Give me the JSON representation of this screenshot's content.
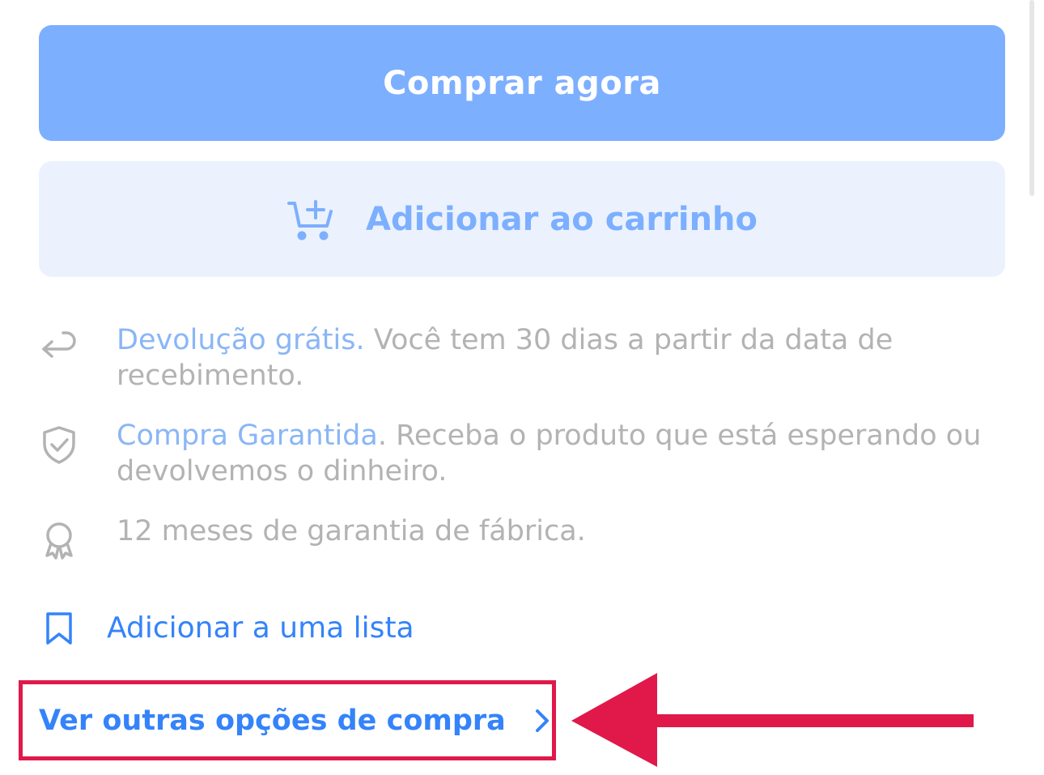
{
  "buttons": {
    "buy_now": "Comprar agora",
    "add_to_cart": "Adicionar ao carrinho"
  },
  "benefits": [
    {
      "icon": "return-arrow-icon",
      "link": "Devolução grátis.",
      "text": " Você tem 30 dias a partir da data de recebimento."
    },
    {
      "icon": "shield-check-icon",
      "link": "Compra Garantida",
      "text": ". Receba o produto que está esperando ou devolvemos o dinheiro."
    },
    {
      "icon": "award-ribbon-icon",
      "text": "12 meses de garantia de fábrica."
    }
  ],
  "add_to_list": "Adicionar a uma lista",
  "other_options": "Ver outras opções de compra",
  "colors": {
    "primary_button": "#7dafff",
    "secondary_button_bg": "#ebf2fd",
    "link_blue": "#3483fa",
    "muted_text": "#b3b3b3",
    "highlight_red": "#e0194a"
  }
}
